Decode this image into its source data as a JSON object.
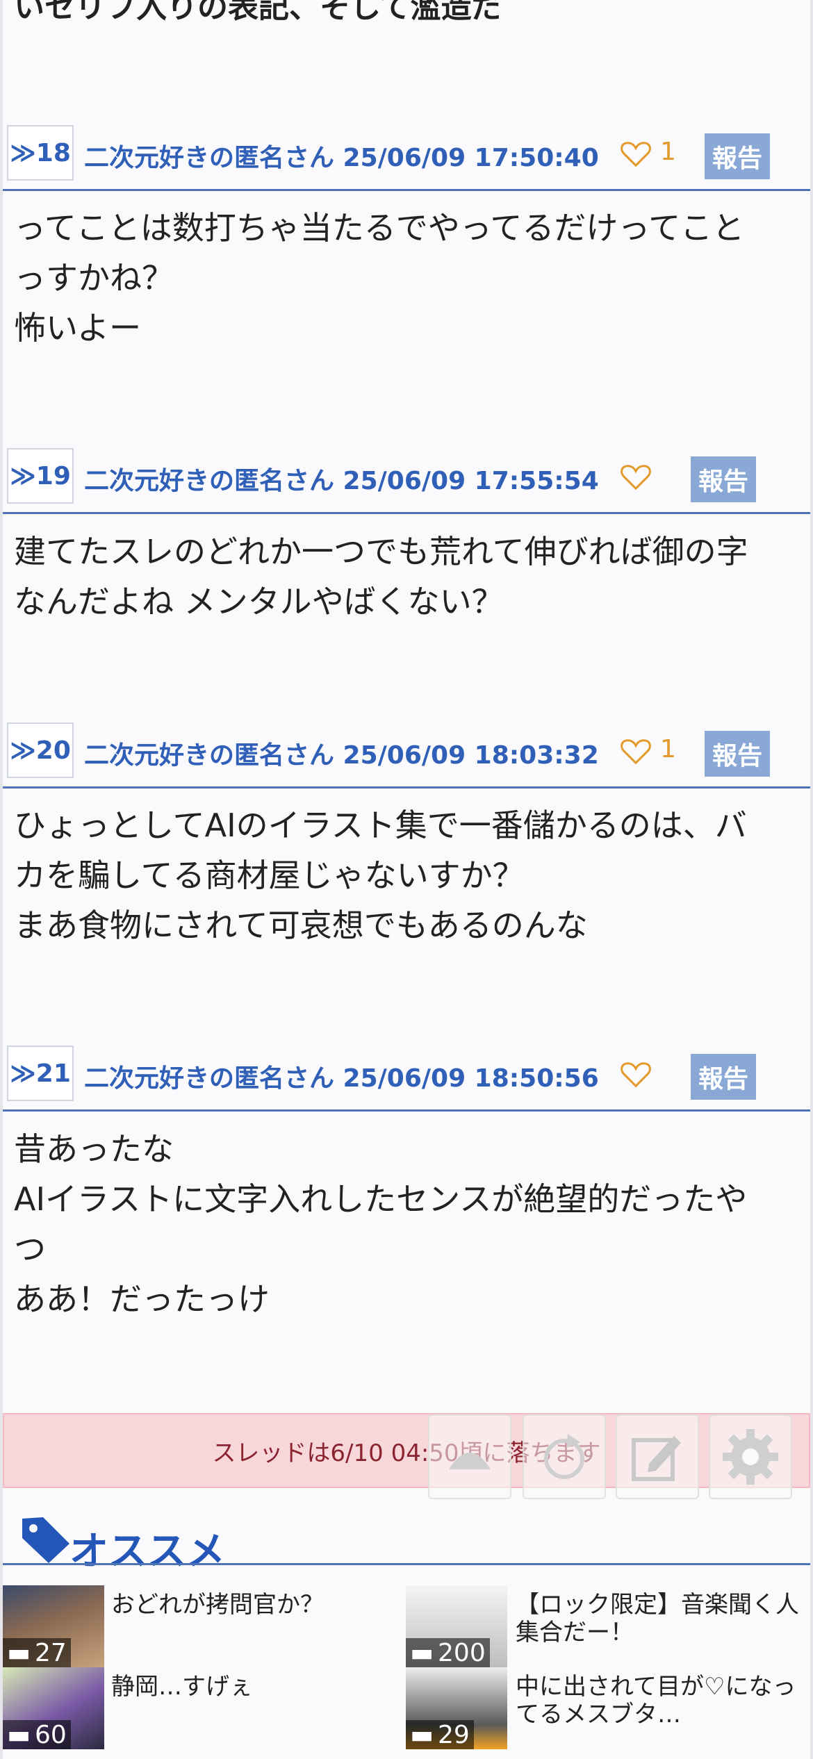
{
  "thread": {
    "title_partial": "いセリフ入りの表記、そして濫造だ"
  },
  "posts": [
    {
      "num": "≫18",
      "author": "二次元好きの匿名さん 25/06/09 17:50:40",
      "likes": "1",
      "report": "報告",
      "lines": [
        "ってことは数打ちゃ当たるでやってるだけってこと",
        "っすかね？",
        "怖いよー"
      ]
    },
    {
      "num": "≫19",
      "author": "二次元好きの匿名さん 25/06/09 17:55:54",
      "likes": "",
      "report": "報告",
      "lines": [
        "建てたスレのどれか一つでも荒れて伸びれば御の字",
        "なんだよね メンタルやばくない？"
      ]
    },
    {
      "num": "≫20",
      "author": "二次元好きの匿名さん 25/06/09 18:03:32",
      "likes": "1",
      "report": "報告",
      "lines": [
        "ひょっとしてAIのイラスト集で一番儲かるのは、バ",
        "カを騙してる商材屋じゃないすか？",
        "まあ食物にされて可哀想でもあるのんな"
      ]
    },
    {
      "num": "≫21",
      "author": "二次元好きの匿名さん 25/06/09 18:50:56",
      "likes": "",
      "report": "報告",
      "lines": [
        "昔あったな",
        "AIイラストに文字入れしたセンスが絶望的だったや",
        "つ",
        "ああ！だったっけ"
      ]
    }
  ],
  "banner": {
    "text": "スレッドは6/10 04:50頃に落ちます"
  },
  "fab": {
    "icons": [
      "scroll-top-icon",
      "refresh-icon",
      "compose-icon",
      "gear-icon"
    ]
  },
  "recommend": {
    "title": "オススメ",
    "items": [
      {
        "count": "27",
        "label": "おどれが拷問官か？"
      },
      {
        "count": "200",
        "label": "【ロック限定】音楽聞く人集合だー！"
      },
      {
        "count": "60",
        "label": "静岡…すげぇ"
      },
      {
        "count": "29",
        "label": "中に出されて目が♡になってるメスブタ…"
      }
    ]
  },
  "colors": {
    "accent": "#2f5fb7",
    "report_bg": "#8aa8d6",
    "like": "#e39a2b",
    "banner_bg": "#f8d7da",
    "banner_text": "#8a2430"
  }
}
